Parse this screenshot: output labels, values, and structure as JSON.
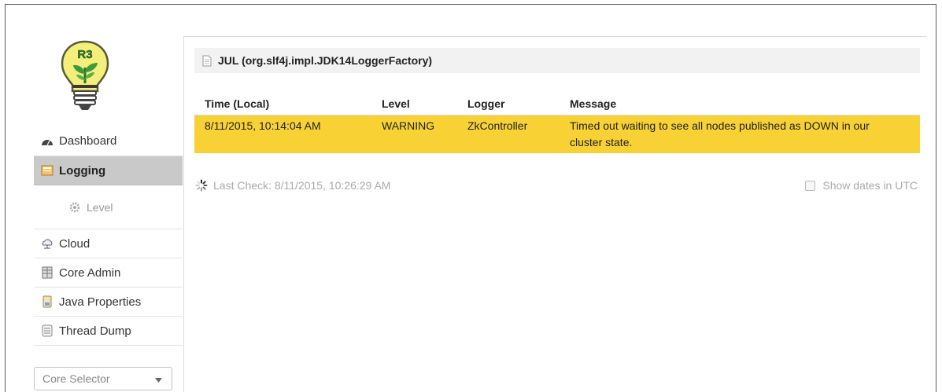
{
  "logo": {
    "text": "R3"
  },
  "sidebar": {
    "items": [
      {
        "label": "Dashboard",
        "icon": "dashboard-icon"
      },
      {
        "label": "Logging",
        "icon": "logging-icon",
        "active": true
      },
      {
        "label": "Level",
        "icon": "gear-icon",
        "sub": true
      },
      {
        "label": "Cloud",
        "icon": "cloud-icon"
      },
      {
        "label": "Core Admin",
        "icon": "core-admin-icon"
      },
      {
        "label": "Java Properties",
        "icon": "java-properties-icon"
      },
      {
        "label": "Thread Dump",
        "icon": "thread-dump-icon"
      }
    ],
    "core_selector": {
      "placeholder": "Core Selector"
    }
  },
  "panel": {
    "title": "JUL (org.slf4j.impl.JDK14LoggerFactory)",
    "columns": [
      "Time (Local)",
      "Level",
      "Logger",
      "Message"
    ],
    "rows": [
      {
        "time": "8/11/2015, 10:14:04 AM",
        "level": "WARNING",
        "logger": "ZkController",
        "message_line1": "Timed out waiting to see all nodes published as DOWN in our",
        "message_line2": "cluster state."
      }
    ],
    "highlight_color": "#f8d234",
    "last_check": "Last Check: 8/11/2015, 10:26:29 AM",
    "show_utc_label": "Show dates in UTC"
  }
}
